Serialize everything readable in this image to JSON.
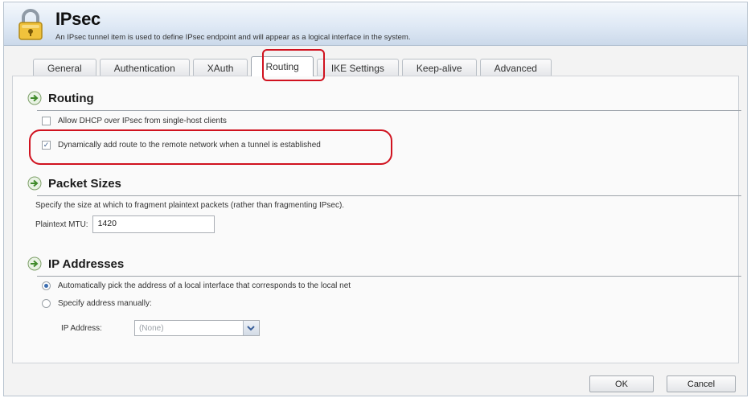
{
  "header": {
    "title": "IPsec",
    "description": "An IPsec tunnel item is used to define IPsec endpoint and will appear as a logical interface in the system."
  },
  "tabs": [
    {
      "label": "General"
    },
    {
      "label": "Authentication"
    },
    {
      "label": "XAuth"
    },
    {
      "label": "Routing",
      "active": true
    },
    {
      "label": "IKE Settings"
    },
    {
      "label": "Keep-alive"
    },
    {
      "label": "Advanced"
    }
  ],
  "routing": {
    "title": "Routing",
    "dhcp_label": "Allow DHCP over IPsec from single-host clients",
    "dhcp_checked": false,
    "dynamic_route_label": "Dynamically add route to the remote network when a tunnel is established",
    "dynamic_route_checked": true
  },
  "packet_sizes": {
    "title": "Packet Sizes",
    "description": "Specify the size at which to fragment plaintext packets (rather than fragmenting IPsec).",
    "mtu_label": "Plaintext MTU:",
    "mtu_value": "1420"
  },
  "ip_addresses": {
    "title": "IP Addresses",
    "auto_label": "Automatically pick the address of a local interface that corresponds to the local net",
    "manual_label": "Specify address manually:",
    "ip_label": "IP Address:",
    "ip_value": "(None)"
  },
  "buttons": {
    "ok": "OK",
    "cancel": "Cancel"
  },
  "colors": {
    "highlight_ring": "#d0121f",
    "header_gradient_end": "#cbd9ea"
  },
  "icons": {
    "header": "lock-icon",
    "section": "green-arrow-icon"
  }
}
